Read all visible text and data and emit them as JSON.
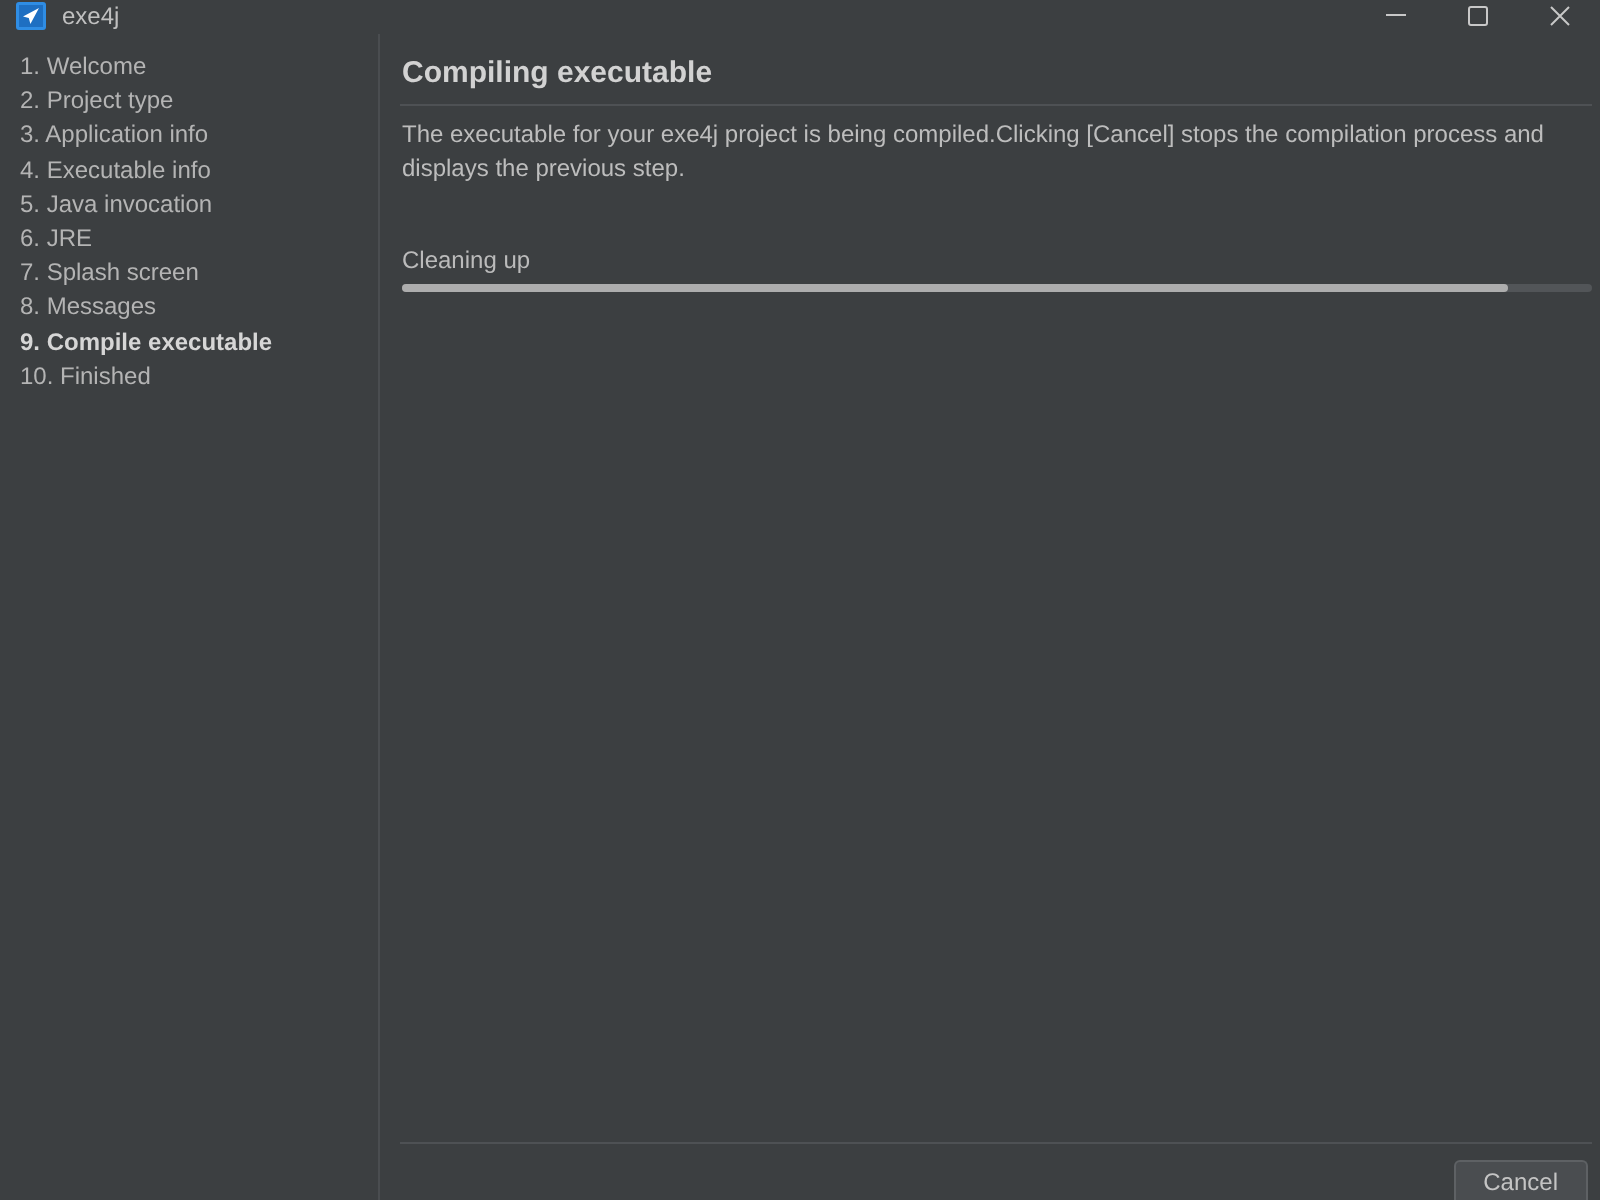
{
  "window": {
    "title": "exe4j"
  },
  "sidebar": {
    "items": [
      {
        "label": "1. Welcome",
        "selected": false
      },
      {
        "label": "2. Project type",
        "selected": false
      },
      {
        "label": "3. Application info",
        "selected": false
      },
      {
        "label": "4. Executable info",
        "selected": false
      },
      {
        "label": "5. Java invocation",
        "selected": false
      },
      {
        "label": "6. JRE",
        "selected": false
      },
      {
        "label": "7. Splash screen",
        "selected": false
      },
      {
        "label": "8. Messages",
        "selected": false
      },
      {
        "label": "9. Compile executable",
        "selected": true
      },
      {
        "label": "10. Finished",
        "selected": false
      }
    ]
  },
  "page": {
    "heading": "Compiling executable",
    "description": "The executable for your exe4j project is being compiled.Clicking [Cancel] stops the compilation process and displays the previous step.",
    "progress": {
      "label": "Cleaning up",
      "level": 0.93
    }
  },
  "buttons": [
    "Cancel"
  ]
}
